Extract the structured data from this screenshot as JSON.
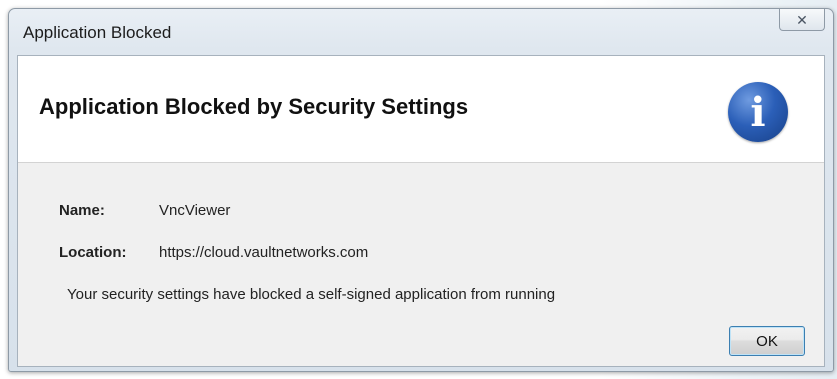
{
  "window": {
    "title": "Application Blocked",
    "close_icon": "close-icon"
  },
  "header": {
    "title": "Application Blocked by Security Settings",
    "icon": "info-icon",
    "icon_glyph": "i",
    "icon_color": "#2b5fb8"
  },
  "details": {
    "name_label": "Name:",
    "name_value": "VncViewer",
    "location_label": "Location:",
    "location_value": "https://cloud.vaultnetworks.com",
    "message": "Your security settings have blocked a self-signed application from running"
  },
  "buttons": {
    "ok_label": "OK"
  }
}
